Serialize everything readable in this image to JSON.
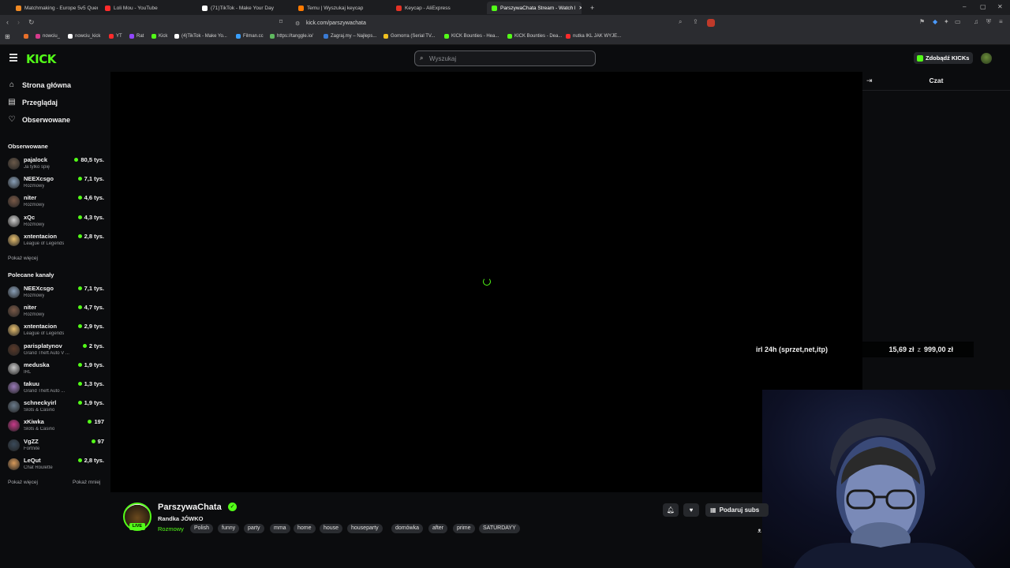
{
  "browser": {
    "tabs": [
      {
        "label": "Matchmaking - Europe 5v5 Queue -",
        "color": "#f08a24"
      },
      {
        "label": "Loli Mou - YouTube",
        "color": "#ff2b2b"
      },
      {
        "label": "(71)TikTok - Make Your Day",
        "color": "#ffffff"
      },
      {
        "label": "Temu | Wyszukaj keycap",
        "color": "#ff7a00"
      },
      {
        "label": "Keycap - AliExpress",
        "color": "#e43225"
      },
      {
        "label": "ParszywaChata Stream - Watch l",
        "color": "#53fc18",
        "active": true
      }
    ],
    "new_tab": "+",
    "url": "kick.com/parszywachata",
    "window_controls": [
      "–",
      "▢",
      "✕"
    ],
    "bookmarks": [
      {
        "label": "",
        "color": "#e8702a"
      },
      {
        "label": "nowciu_",
        "color": "#d63a8c"
      },
      {
        "label": "nowciu_kick",
        "color": "#ffffff"
      },
      {
        "label": "YT",
        "color": "#ff2b2b"
      },
      {
        "label": "Rat",
        "color": "#9146ff"
      },
      {
        "label": "Kick",
        "color": "#53fc18"
      },
      {
        "label": "(4)TikTok - Make Yo...",
        "color": "#ffffff"
      },
      {
        "label": "Filman.cc",
        "color": "#3aa0ff"
      },
      {
        "label": "https://tanggle.io/",
        "color": "#5fb85f"
      },
      {
        "label": "Zagraj.my – Najleps...",
        "color": "#3a7bd5"
      },
      {
        "label": "Gomorra (Serial TV...",
        "color": "#f0c020"
      },
      {
        "label": "KICK Bounties - Hea...",
        "color": "#53fc18"
      },
      {
        "label": "KICK Bounties - Dea...",
        "color": "#53fc18"
      },
      {
        "label": "nutka IKL JAK WYJE...",
        "color": "#ff2b2b"
      }
    ]
  },
  "header": {
    "logo": "KICK",
    "search_placeholder": "Wyszukaj",
    "kicks_button": "Zdobądź KICKs"
  },
  "sidebar": {
    "nav": [
      {
        "label": "Strona główna",
        "icon": "home-icon",
        "glyph": "⌂"
      },
      {
        "label": "Przeglądaj",
        "icon": "browse-icon",
        "glyph": "▤"
      },
      {
        "label": "Obserwowane",
        "icon": "heart-icon",
        "glyph": "♡"
      }
    ],
    "followed_title": "Obserwowane",
    "followed": [
      {
        "name": "pajalock",
        "category": "Ja tylko śpię",
        "viewers": "80,5 tys.",
        "color": "#6b5a4a"
      },
      {
        "name": "NEEXcsgo",
        "category": "Rozmowy",
        "viewers": "7,1 tys.",
        "color": "#8aa0b8"
      },
      {
        "name": "niter",
        "category": "Rozmowy",
        "viewers": "4,6 tys.",
        "color": "#7a5a48"
      },
      {
        "name": "xQc",
        "category": "Rozmowy",
        "viewers": "4,3 tys.",
        "color": "#d0d0d0"
      },
      {
        "name": "xntentacion",
        "category": "League of Legends",
        "viewers": "2,8 tys.",
        "color": "#e8c070"
      }
    ],
    "followed_more": "Pokaż więcej",
    "recommended_title": "Polecane kanały",
    "recommended": [
      {
        "name": "NEEXcsgo",
        "category": "Rozmowy",
        "viewers": "7,1 tys.",
        "color": "#8aa0b8"
      },
      {
        "name": "niter",
        "category": "Rozmowy",
        "viewers": "4,7 tys.",
        "color": "#7a5a48"
      },
      {
        "name": "xntentacion",
        "category": "League of Legends",
        "viewers": "2,9 tys.",
        "color": "#e8c070"
      },
      {
        "name": "parisplatynov",
        "category": "Grand Theft Auto V ...",
        "viewers": "2 tys.",
        "color": "#5a3a2a"
      },
      {
        "name": "meduska",
        "category": "IRL",
        "viewers": "1,9 tys.",
        "color": "#c8c8c8"
      },
      {
        "name": "takuu",
        "category": "Grand Theft Auto ...",
        "viewers": "1,3 tys.",
        "color": "#9a7ab8"
      },
      {
        "name": "schneckyirl",
        "category": "Slots & Casino",
        "viewers": "1,9 tys.",
        "color": "#6a7a8a"
      },
      {
        "name": "xKiwka",
        "category": "Slots & Casino",
        "viewers": "197",
        "color": "#c83a8a"
      },
      {
        "name": "VgZZ",
        "category": "Fortnite",
        "viewers": "97",
        "color": "#3a4a5a"
      },
      {
        "name": "LeQut",
        "category": "Chat Roulette",
        "viewers": "2,8 tys.",
        "color": "#d89a5a"
      }
    ],
    "recommended_more": "Pokaż więcej",
    "recommended_less": "Pokaż mniej"
  },
  "chat": {
    "title": "Czat"
  },
  "overlay": {
    "goal_label": "irl 24h (sprzet,net,itp)",
    "goal_current": "15,69 zł",
    "goal_sep": "z",
    "goal_target": "999,00 zł"
  },
  "stream": {
    "streamer": "ParszywaChata",
    "live_badge": "LIVE",
    "title": "Randka JÓWKO",
    "category": "Rozmowy",
    "tags": [
      "Polish",
      "funny",
      "party",
      "mma",
      "home",
      "house",
      "houseparty",
      "domówka",
      "after",
      "prime",
      "SATURDAYY"
    ],
    "gift_button": "Podaruj subs"
  }
}
